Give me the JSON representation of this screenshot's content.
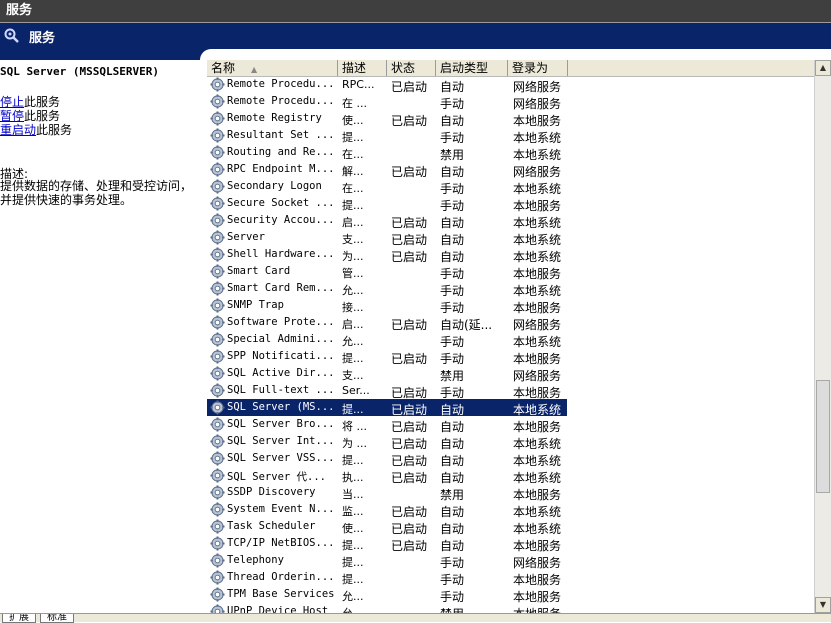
{
  "window": {
    "title": "服务"
  },
  "header": {
    "title": "服务"
  },
  "left_panel": {
    "service_name": "SQL Server (MSSQLSERVER)",
    "actions": [
      {
        "link": "停止",
        "suffix": "此服务"
      },
      {
        "link": "暂停",
        "suffix": "此服务"
      },
      {
        "link": "重启动",
        "suffix": "此服务"
      }
    ],
    "description_label": "描述:",
    "description": "提供数据的存储、处理和受控访问，并提供快速的事务处理。"
  },
  "columns": [
    "名称",
    "描述",
    "状态",
    "启动类型",
    "登录为"
  ],
  "services": [
    {
      "name": "Remote Procedu...",
      "desc": "RPC...",
      "status": "已启动",
      "startup": "自动",
      "logon": "网络服务"
    },
    {
      "name": "Remote Procedu...",
      "desc": "在 ...",
      "status": "",
      "startup": "手动",
      "logon": "网络服务"
    },
    {
      "name": "Remote Registry",
      "desc": "使...",
      "status": "已启动",
      "startup": "自动",
      "logon": "本地服务"
    },
    {
      "name": "Resultant Set ...",
      "desc": "提...",
      "status": "",
      "startup": "手动",
      "logon": "本地系统"
    },
    {
      "name": "Routing and Re...",
      "desc": "在...",
      "status": "",
      "startup": "禁用",
      "logon": "本地系统"
    },
    {
      "name": "RPC Endpoint M...",
      "desc": "解...",
      "status": "已启动",
      "startup": "自动",
      "logon": "网络服务"
    },
    {
      "name": "Secondary Logon",
      "desc": "在...",
      "status": "",
      "startup": "手动",
      "logon": "本地系统"
    },
    {
      "name": "Secure Socket ...",
      "desc": "提...",
      "status": "",
      "startup": "手动",
      "logon": "本地服务"
    },
    {
      "name": "Security Accou...",
      "desc": "启...",
      "status": "已启动",
      "startup": "自动",
      "logon": "本地系统"
    },
    {
      "name": "Server",
      "desc": "支...",
      "status": "已启动",
      "startup": "自动",
      "logon": "本地系统"
    },
    {
      "name": "Shell Hardware...",
      "desc": "为...",
      "status": "已启动",
      "startup": "自动",
      "logon": "本地系统"
    },
    {
      "name": "Smart Card",
      "desc": "管...",
      "status": "",
      "startup": "手动",
      "logon": "本地服务"
    },
    {
      "name": "Smart Card Rem...",
      "desc": "允...",
      "status": "",
      "startup": "手动",
      "logon": "本地系统"
    },
    {
      "name": "SNMP Trap",
      "desc": "接...",
      "status": "",
      "startup": "手动",
      "logon": "本地服务"
    },
    {
      "name": "Software Prote...",
      "desc": "启...",
      "status": "已启动",
      "startup": "自动(延...",
      "logon": "网络服务"
    },
    {
      "name": "Special Admini...",
      "desc": "允...",
      "status": "",
      "startup": "手动",
      "logon": "本地系统"
    },
    {
      "name": "SPP Notificati...",
      "desc": "提...",
      "status": "已启动",
      "startup": "手动",
      "logon": "本地服务"
    },
    {
      "name": "SQL Active Dir...",
      "desc": "支...",
      "status": "",
      "startup": "禁用",
      "logon": "网络服务"
    },
    {
      "name": "SQL Full-text ...",
      "desc": "Ser...",
      "status": "已启动",
      "startup": "手动",
      "logon": "本地服务"
    },
    {
      "name": "SQL Server (MS...",
      "desc": "提...",
      "status": "已启动",
      "startup": "自动",
      "logon": "本地系统",
      "selected": true
    },
    {
      "name": "SQL Server Bro...",
      "desc": "将 ...",
      "status": "已启动",
      "startup": "自动",
      "logon": "本地服务"
    },
    {
      "name": "SQL Server Int...",
      "desc": "为 ...",
      "status": "已启动",
      "startup": "自动",
      "logon": "本地系统"
    },
    {
      "name": "SQL Server VSS...",
      "desc": "提...",
      "status": "已启动",
      "startup": "自动",
      "logon": "本地系统"
    },
    {
      "name": "SQL Server 代...",
      "desc": "执...",
      "status": "已启动",
      "startup": "自动",
      "logon": "本地系统"
    },
    {
      "name": "SSDP Discovery",
      "desc": "当...",
      "status": "",
      "startup": "禁用",
      "logon": "本地服务"
    },
    {
      "name": "System Event N...",
      "desc": "监...",
      "status": "已启动",
      "startup": "自动",
      "logon": "本地系统"
    },
    {
      "name": "Task Scheduler",
      "desc": "使...",
      "status": "已启动",
      "startup": "自动",
      "logon": "本地系统"
    },
    {
      "name": "TCP/IP NetBIOS...",
      "desc": "提...",
      "status": "已启动",
      "startup": "自动",
      "logon": "本地服务"
    },
    {
      "name": "Telephony",
      "desc": "提...",
      "status": "",
      "startup": "手动",
      "logon": "网络服务"
    },
    {
      "name": "Thread Orderin...",
      "desc": "提...",
      "status": "",
      "startup": "手动",
      "logon": "本地服务"
    },
    {
      "name": "TPM Base Services",
      "desc": "允...",
      "status": "",
      "startup": "手动",
      "logon": "本地服务"
    },
    {
      "name": "UPnP Device Host",
      "desc": "允...",
      "status": "",
      "startup": "禁用",
      "logon": "本地服务"
    }
  ],
  "bottom_tabs": [
    "扩展",
    "标准"
  ],
  "colors": {
    "header": "#0a246a",
    "selection": "#0a246a",
    "link": "#0000cc"
  },
  "icons": {
    "header": "gear-search-icon",
    "row": "service-gear-icon"
  }
}
